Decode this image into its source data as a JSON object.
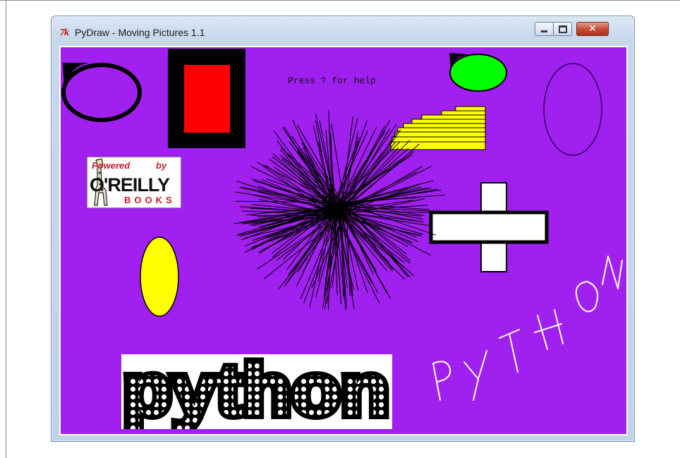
{
  "window": {
    "title": "PyDraw - Moving Pictures 1.1",
    "app_icon": "tk-feather-icon",
    "app_icon_text": "7k",
    "controls": [
      "minimize-icon",
      "maximize-icon",
      "close-icon"
    ],
    "close_glyph": "✕"
  },
  "canvas": {
    "background": "#a020f0",
    "help_text": "Press ? for help",
    "logos": {
      "oreilly": {
        "powered": "Powered",
        "by": "by",
        "name": "O'REILLY",
        "books": "BOOKS"
      },
      "python": {
        "text": "python"
      }
    },
    "handwriting": "PYTHON",
    "colors": {
      "red": "#ff0000",
      "green": "#00ff00",
      "yellow": "#ffff00",
      "white": "#ffffff",
      "black": "#000000",
      "purple_outline": "#3a0060"
    }
  }
}
